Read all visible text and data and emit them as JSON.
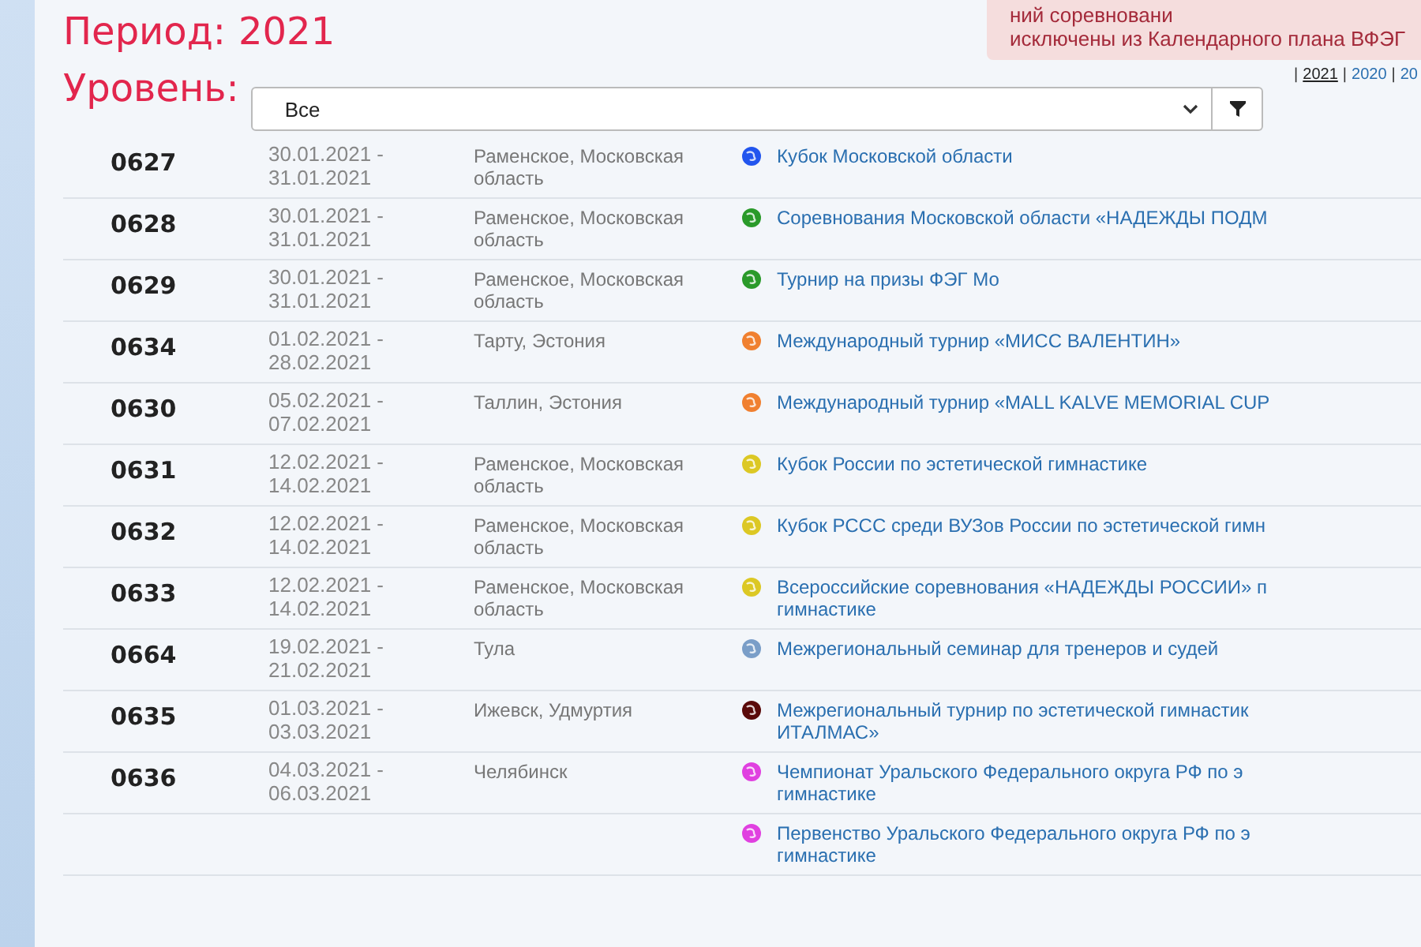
{
  "notice": {
    "lines": [
      "ний соревновани",
      "исключены из Календарного плана ВФЭГ"
    ]
  },
  "period": {
    "label": "Период:",
    "value": "2021"
  },
  "years": [
    {
      "separator": "|",
      "label": "2021",
      "selected": true
    },
    {
      "separator": "|",
      "label": "2020",
      "selected": false
    },
    {
      "separator": "|",
      "label": "20",
      "selected": false
    }
  ],
  "level": {
    "label": "Уровень:",
    "value": "Все"
  },
  "events": [
    {
      "number": "0627",
      "dates": [
        "30.01.2021 -",
        "31.01.2021"
      ],
      "place": "Раменское, Московская область",
      "color": "#2255ee",
      "title": [
        "Кубок Московской области"
      ]
    },
    {
      "number": "0628",
      "dates": [
        "30.01.2021 -",
        "31.01.2021"
      ],
      "place": "Раменское, Московская область",
      "color": "#2a9a2a",
      "title": [
        "Соревнования Московской области «НАДЕЖДЫ ПОДМ"
      ]
    },
    {
      "number": "0629",
      "dates": [
        "30.01.2021 -",
        "31.01.2021"
      ],
      "place": "Раменское, Московская область",
      "color": "#2a9a2a",
      "title": [
        "Турнир на призы ФЭГ Мо"
      ]
    },
    {
      "number": "0634",
      "dates": [
        "01.02.2021 -",
        "28.02.2021"
      ],
      "place": "Тарту, Эстония",
      "color": "#f08030",
      "title": [
        "Международный турнир «МИСС ВАЛЕНТИН»"
      ]
    },
    {
      "number": "0630",
      "dates": [
        "05.02.2021 -",
        "07.02.2021"
      ],
      "place": "Таллин, Эстония",
      "color": "#f08030",
      "title": [
        "Международный турнир «MALL KALVE MEMORIAL CUP"
      ]
    },
    {
      "number": "0631",
      "dates": [
        "12.02.2021 -",
        "14.02.2021"
      ],
      "place": "Раменское, Московская область",
      "color": "#dcc824",
      "title": [
        "Кубок России по эстетической гимнастике"
      ]
    },
    {
      "number": "0632",
      "dates": [
        "12.02.2021 -",
        "14.02.2021"
      ],
      "place": "Раменское, Московская область",
      "color": "#dcc824",
      "title": [
        "Кубок РССС среди ВУЗов России по эстетической гимн"
      ]
    },
    {
      "number": "0633",
      "dates": [
        "12.02.2021 -",
        "14.02.2021"
      ],
      "place": "Раменское, Московская область",
      "color": "#dcc824",
      "title": [
        "Всероссийские соревнования «НАДЕЖДЫ РОССИИ» п",
        "гимнастике"
      ]
    },
    {
      "number": "0664",
      "dates": [
        "19.02.2021 -",
        "21.02.2021"
      ],
      "place": "Тула",
      "color": "#7a9ec8",
      "title": [
        "Межрегиональный семинар для тренеров и судей"
      ]
    },
    {
      "number": "0635",
      "dates": [
        "01.03.2021 -",
        "03.03.2021"
      ],
      "place": "Ижевск, Удмуртия",
      "color": "#5a0a0a",
      "title": [
        "Межрегиональный турнир по эстетической гимнастик",
        "ИТАЛМАС»"
      ]
    },
    {
      "number": "0636",
      "dates": [
        "04.03.2021 -",
        "06.03.2021"
      ],
      "place": "Челябинск",
      "color": "#e040e0",
      "title": [
        "Чемпионат Уральского Федерального округа РФ по э",
        "гимнастике"
      ]
    },
    {
      "color": "#e040e0",
      "title": [
        "Первенство Уральского Федерального округа РФ по э",
        "гимнастике"
      ]
    }
  ]
}
